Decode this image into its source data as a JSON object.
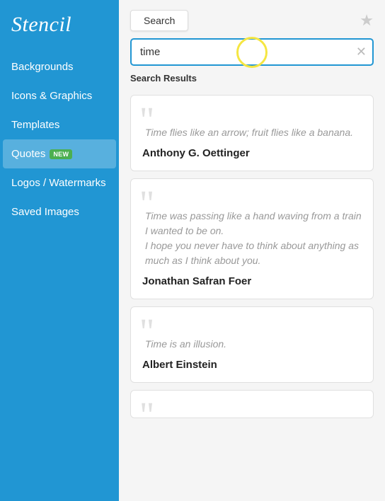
{
  "app": {
    "logo": "Stencil"
  },
  "sidebar": {
    "items": [
      {
        "id": "backgrounds",
        "label": "Backgrounds",
        "active": false,
        "badge": null
      },
      {
        "id": "icons-graphics",
        "label": "Icons & Graphics",
        "active": false,
        "badge": null
      },
      {
        "id": "templates",
        "label": "Templates",
        "active": false,
        "badge": null
      },
      {
        "id": "quotes",
        "label": "Quotes",
        "active": true,
        "badge": "NEW"
      },
      {
        "id": "logos-watermarks",
        "label": "Logos / Watermarks",
        "active": false,
        "badge": null
      },
      {
        "id": "saved-images",
        "label": "Saved Images",
        "active": false,
        "badge": null
      }
    ]
  },
  "header": {
    "search_tab_label": "Search",
    "star_icon": "★",
    "search_placeholder": "Search...",
    "search_value": "time",
    "results_label": "Search Results"
  },
  "results": [
    {
      "id": "result-1",
      "quote": "Time flies like an arrow; fruit flies like a banana.",
      "author": "Anthony G. Oettinger"
    },
    {
      "id": "result-2",
      "quote": "Time was passing like a hand waving from a train I wanted to be on.\nI hope you never have to think about anything as much as I think about you.",
      "author": "Jonathan Safran Foer"
    },
    {
      "id": "result-3",
      "quote": "Time is an illusion.",
      "author": "Albert Einstein"
    },
    {
      "id": "result-4",
      "quote": "",
      "author": ""
    }
  ]
}
